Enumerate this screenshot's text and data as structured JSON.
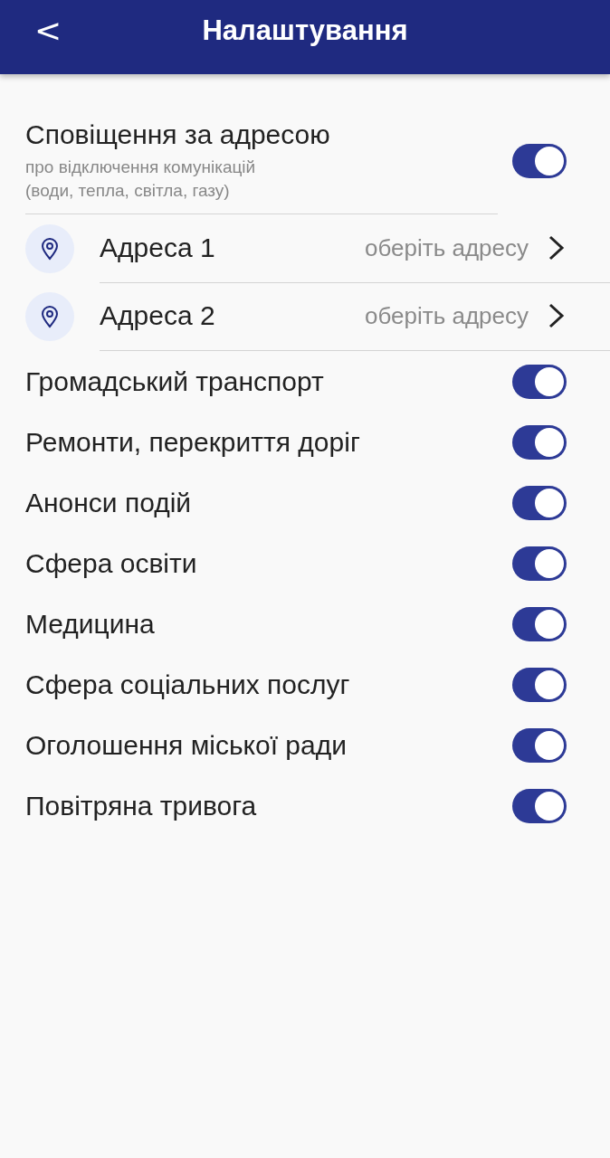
{
  "header": {
    "back": "<",
    "title": "Налаштування"
  },
  "address_alerts": {
    "title": "Сповіщення за адресою",
    "subtitle": "про відключення комунікацій\n(води, тепла, світла, газу)",
    "on": true,
    "addresses": [
      {
        "label": "Адреса 1",
        "placeholder": "оберіть адресу"
      },
      {
        "label": "Адреса 2",
        "placeholder": "оберіть адресу"
      }
    ]
  },
  "toggles": [
    {
      "label": "Громадський транспорт",
      "on": true
    },
    {
      "label": "Ремонти, перекриття доріг",
      "on": true
    },
    {
      "label": "Анонси подій",
      "on": true
    },
    {
      "label": "Сфера освіти",
      "on": true
    },
    {
      "label": "Медицина",
      "on": true
    },
    {
      "label": "Сфера соціальних послуг",
      "on": true
    },
    {
      "label": "Оголошення міської ради",
      "on": true
    },
    {
      "label": "Повітряна тривога",
      "on": true
    }
  ]
}
